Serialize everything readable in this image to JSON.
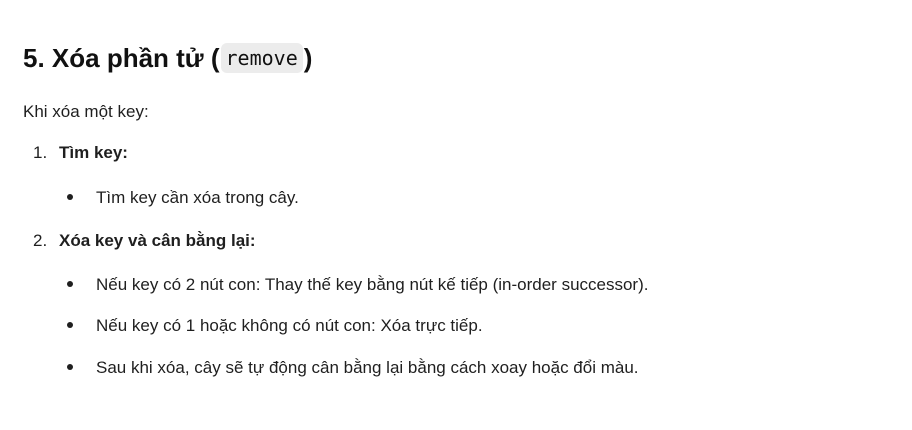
{
  "section": {
    "heading_prefix": "5. Xóa phần tử (",
    "heading_code": "remove",
    "heading_suffix": ")"
  },
  "intro": "Khi xóa một key:",
  "steps": [
    {
      "number": "1.",
      "label": "Tìm key:",
      "bullets": [
        "Tìm key cần xóa trong cây."
      ]
    },
    {
      "number": "2.",
      "label": "Xóa key và cân bằng lại:",
      "bullets": [
        "Nếu key có 2 nút con: Thay thế key bằng nút kế tiếp (in-order successor).",
        "Nếu key có 1 hoặc không có nút con: Xóa trực tiếp.",
        "Sau khi xóa, cây sẽ tự động cân bằng lại bằng cách xoay hoặc đổi màu."
      ]
    }
  ]
}
